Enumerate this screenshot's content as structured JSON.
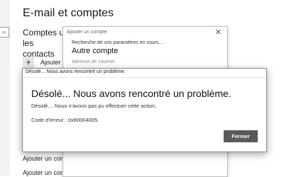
{
  "settings": {
    "page_title": "E-mail et comptes",
    "section_heading_line1": "Comptes utilisés par d'autres applications",
    "section_heading_line2": "les contacts",
    "add_account_label": "Ajouter un compte",
    "add_account_icon": "plus-icon",
    "search_icon": "search-icon",
    "bottom_links": [
      "Ajouter un compte",
      "Ajouter un compte"
    ]
  },
  "add_dialog": {
    "title": "Ajouter un compte",
    "close_glyph": "✕",
    "searching_text": "Recherche de vos paramètres en cours...",
    "heading": "Autre compte",
    "email_placeholder": "Adresse de courrier"
  },
  "error_dialog": {
    "window_title": "Désolé... Nous avons rencontré un problème.",
    "heading": "Désolé... Nous avons rencontré un problème.",
    "message": "Désolé… Nous n'avons pas pu effectuer cette action.",
    "error_code": "Code d'erreur : 0x80004005.",
    "close_button_label": "Fermer",
    "button_color": "#5a5a5a"
  }
}
